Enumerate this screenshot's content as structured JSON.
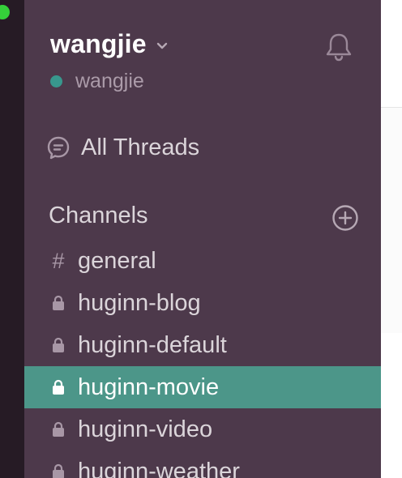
{
  "sidebar": {
    "team_name": "wangjie",
    "user_name": "wangjie",
    "status": "online",
    "all_threads_label": "All Threads",
    "channels_label": "Channels",
    "channels": [
      {
        "type": "public",
        "glyph": "#",
        "label": "general",
        "active": false
      },
      {
        "type": "private",
        "label": "huginn-blog",
        "active": false
      },
      {
        "type": "private",
        "label": "huginn-default",
        "active": false
      },
      {
        "type": "private",
        "label": "huginn-movie",
        "active": true
      },
      {
        "type": "private",
        "label": "huginn-video",
        "active": false
      },
      {
        "type": "private",
        "label": "huginn-weather",
        "active": false
      }
    ]
  },
  "icons": {
    "team_caret": "chevron-down-icon",
    "notifications": "bell-icon",
    "threads": "threads-icon",
    "add_channel": "plus-circle-icon",
    "private_channel": "lock-icon",
    "public_channel": "hash-icon"
  },
  "colors": {
    "sidebar_bg": "#4d394b",
    "rail_bg": "#261b25",
    "active_channel_bg": "#4c9689",
    "presence_green": "#35d03a",
    "status_teal": "#38978d",
    "muted_text": "#ab9ba9",
    "channel_text": "#dbd5da"
  }
}
